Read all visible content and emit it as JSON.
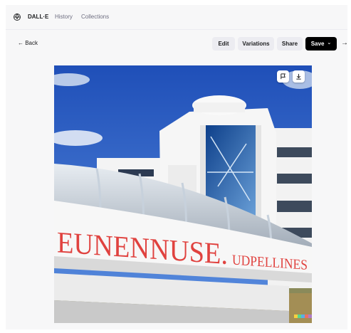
{
  "app": {
    "brand": "DALL·E",
    "nav": [
      "History",
      "Collections"
    ]
  },
  "toolbar": {
    "back_label": "← Back",
    "edit_label": "Edit",
    "variations_label": "Variations",
    "share_label": "Share",
    "save_label": "Save",
    "save_chevron": "⌄",
    "collapse_icon": "→|"
  },
  "image": {
    "banner_text": "EUNENNUSE. UDPELLINES",
    "overlay_actions": [
      "flag-icon",
      "download-icon"
    ]
  },
  "colors": {
    "accent_dark": "#000000",
    "button_bg": "#ececf1"
  }
}
